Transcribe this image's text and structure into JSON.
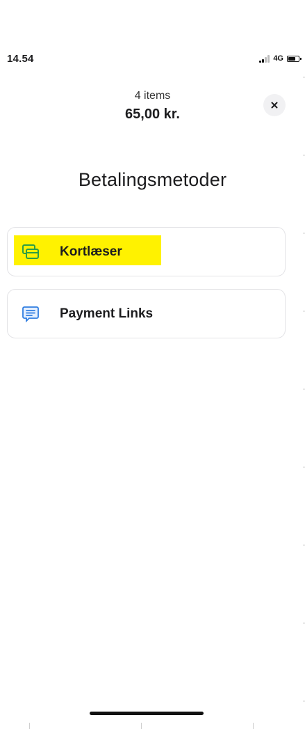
{
  "status_bar": {
    "time": "14.54",
    "network": "4G",
    "signal_bars": 2,
    "signal_total": 4
  },
  "header": {
    "items_count": "4 items",
    "total": "65,00 kr.",
    "close_icon": "close-icon"
  },
  "title": "Betalingsmetoder",
  "methods": [
    {
      "label": "Kortlæser",
      "icon": "card-reader-icon",
      "icon_color": "#2e9e45",
      "highlighted": true,
      "highlight_color": "#fff200"
    },
    {
      "label": "Payment Links",
      "icon": "message-icon",
      "icon_color": "#2f7de1",
      "highlighted": false
    }
  ]
}
